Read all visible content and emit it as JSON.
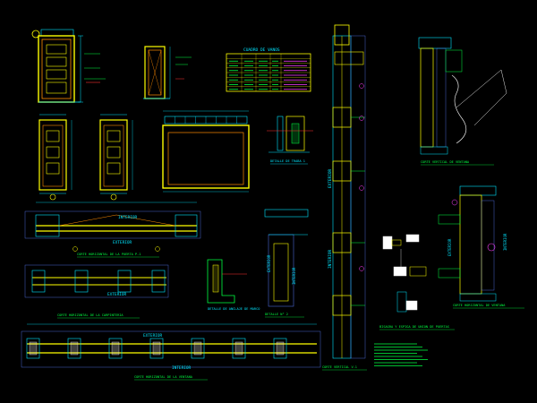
{
  "colors": {
    "background": "#000000",
    "cyan": "#00e5ff",
    "yellow": "#ffff00",
    "orange": "#ff8c00",
    "red": "#ff3030",
    "green": "#00ff40",
    "magenta": "#ff40ff",
    "white": "#e8e8e8",
    "blue": "#5a7dff",
    "gray": "#8a8a8a"
  },
  "labels": {
    "table_title": "CUADRO DE VANOS",
    "exterior": "EXTERIOR",
    "interior": "INTERIOR",
    "caption_planta_puerta": "CORTE HORIZONTAL DE LA PUERTA P-1",
    "caption_carpinteria": "CORTE HORIZONTAL DE LA CARPINTERIA",
    "caption_ventana_bottom": "CORTE HORIZONTAL DE LA VENTANA",
    "caption_detalle_1": "DETALLE DE TRABA 1",
    "caption_detalle_2": "DETALLE N° 2",
    "caption_detalle_3": "DETALLE DE ANCLAJE DE MARCO",
    "caption_corte_vertical": "CORTE VERTICAL V-1",
    "caption_corte_vertical_ventana": "CORTE VERTICAL DE VENTANA",
    "caption_corte_horizontal_ventana": "CORTE HORIZONTAL DE VENTANA",
    "caption_bisagra": "BISAGRA Y ESPIGA DE UNION DE PUERTAS"
  }
}
